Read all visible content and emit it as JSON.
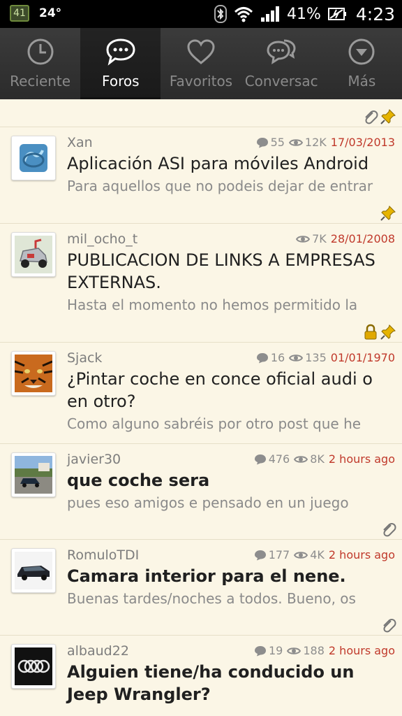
{
  "status_bar": {
    "notification_badge": "41",
    "temperature": "24°",
    "battery_percent": "41%",
    "time": "4:23"
  },
  "tabs": [
    {
      "label": "Reciente",
      "icon": "clock-icon",
      "active": false
    },
    {
      "label": "Foros",
      "icon": "chat-bubble-icon",
      "active": true
    },
    {
      "label": "Favoritos",
      "icon": "heart-icon",
      "active": false
    },
    {
      "label": "Conversac",
      "icon": "conversation-icon",
      "active": false
    },
    {
      "label": "Más",
      "icon": "chevron-down-circle-icon",
      "active": false
    }
  ],
  "threads": [
    {
      "author": "Xan",
      "replies": "55",
      "views": "12K",
      "date": "17/03/2013",
      "title": "Aplicación ASI para móviles Android",
      "snippet": "Para aquellos que no podeis dejar de entrar",
      "bold": false
    },
    {
      "author": "mil_ocho_t",
      "replies": "",
      "views": "7K",
      "date": "28/01/2008",
      "title": "PUBLICACION DE LINKS A EMPRESAS EXTERNAS.",
      "snippet": "Hasta el momento no hemos permitido la",
      "bold": false
    },
    {
      "author": "Sjack",
      "replies": "16",
      "views": "135",
      "date": "01/01/1970",
      "title": "¿Pintar coche en conce oficial audi o en otro?",
      "snippet": "Como alguno sabréis por otro post que he",
      "bold": false
    },
    {
      "author": "javier30",
      "replies": "476",
      "views": "8K",
      "date": "2 hours ago",
      "title": "que coche sera",
      "snippet": "pues eso amigos e pensado en un juego",
      "bold": true
    },
    {
      "author": "RomuloTDI",
      "replies": "177",
      "views": "4K",
      "date": "2 hours ago",
      "title": "Camara interior para el nene.",
      "snippet": "Buenas tardes/noches a todos. Bueno, os",
      "bold": true
    },
    {
      "author": "albaud22",
      "replies": "19",
      "views": "188",
      "date": "2 hours ago",
      "title": "Alguien tiene/ha conducido un Jeep Wrangler?",
      "snippet": "",
      "bold": true
    }
  ],
  "colors": {
    "list_background": "#fbf6e6",
    "date_color": "#c0392b",
    "tabbar_background": "#333333"
  }
}
